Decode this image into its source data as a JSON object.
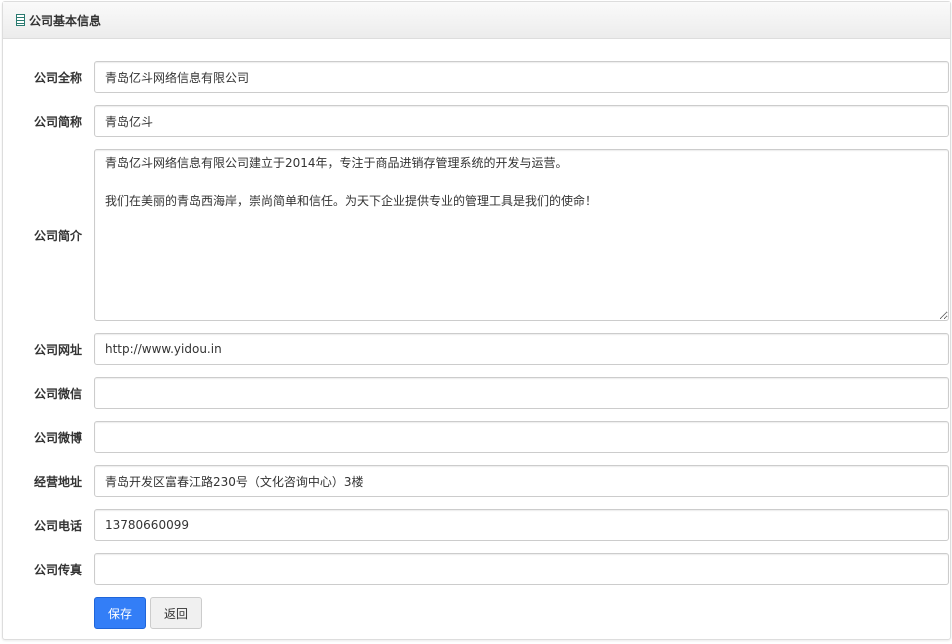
{
  "panel": {
    "title": "公司基本信息",
    "icon": "building-icon"
  },
  "fields": [
    {
      "label": "公司全称",
      "value": "青岛亿斗网络信息有限公司"
    },
    {
      "label": "公司简称",
      "value": "青岛亿斗"
    },
    {
      "label": "公司简介",
      "value": "青岛亿斗网络信息有限公司建立于2014年，专注于商品进销存管理系统的开发与运营。\n\n我们在美丽的青岛西海岸，崇尚简单和信任。为天下企业提供专业的管理工具是我们的使命！"
    },
    {
      "label": "公司网址",
      "value": "http://www.yidou.in"
    },
    {
      "label": "公司微信",
      "value": ""
    },
    {
      "label": "公司微博",
      "value": ""
    },
    {
      "label": "经营地址",
      "value": "青岛开发区富春江路230号（文化咨询中心）3楼"
    },
    {
      "label": "公司电话",
      "value": "13780660099"
    },
    {
      "label": "公司传真",
      "value": ""
    }
  ],
  "buttons": {
    "save": "保存",
    "back": "返回"
  }
}
